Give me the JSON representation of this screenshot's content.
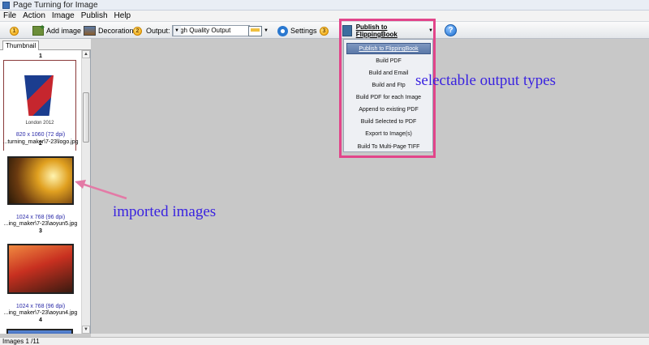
{
  "window": {
    "title": "Page Turning for Image"
  },
  "menu": [
    "File",
    "Action",
    "Image",
    "Publish",
    "Help"
  ],
  "toolbar": {
    "step1": "1",
    "add_image_label": "Add image",
    "decoration_label": "Decoration",
    "step2": "2",
    "output_label": "Output:",
    "output_value": "High Quality Output",
    "settings_label": "Settings",
    "step3": "3",
    "publish_label": "Publish to FlippingBook",
    "help_glyph": "?"
  },
  "left_panel": {
    "tab": "Thumbnail",
    "thumbnails": [
      {
        "index": "1",
        "info": "820 x 1060 (72 dpi)",
        "path": "...turning_maker\\7-23\\logo.jpg",
        "logo_text": "London 2012"
      },
      {
        "index": "2",
        "info": "1024 x 768 (96 dpi)",
        "path": "...ing_maker\\7-23\\aoyun5.jpg"
      },
      {
        "index": "3",
        "info": "1024 x 768 (96 dpi)",
        "path": "...ing_maker\\7-23\\aoyun4.jpg"
      },
      {
        "index": "4"
      }
    ]
  },
  "publish_menu": {
    "items": [
      "Publish to FlippingBook",
      "Build PDF",
      "Build and Email",
      "Build and Ftp",
      "Build PDF for each Image",
      "Append to existing PDF",
      "Build Selected to PDF",
      "Export to Image(s)",
      "Build To Multi-Page TIFF"
    ],
    "active_index": 0
  },
  "annotations": {
    "output_types": "selectable output types",
    "imported_images": "imported images"
  },
  "status": {
    "text": "Images 1 /11"
  },
  "colors": {
    "highlight": "#e2458a",
    "annotation": "#3a23e0"
  }
}
